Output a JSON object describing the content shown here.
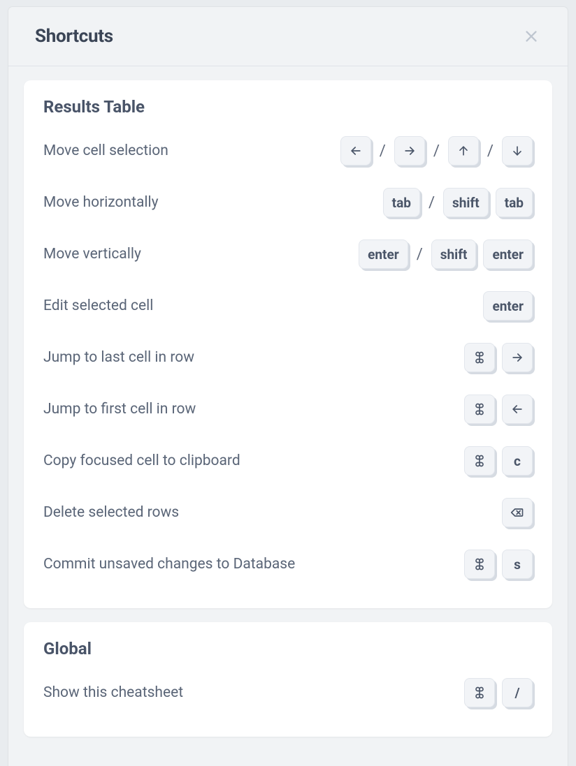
{
  "modal": {
    "title": "Shortcuts"
  },
  "sections": [
    {
      "title": "Results Table",
      "rows": [
        {
          "label": "Move cell selection",
          "keys": [
            {
              "type": "icon",
              "name": "arrow-left"
            },
            {
              "type": "sep",
              "text": "/"
            },
            {
              "type": "icon",
              "name": "arrow-right"
            },
            {
              "type": "sep",
              "text": "/"
            },
            {
              "type": "icon",
              "name": "arrow-up"
            },
            {
              "type": "sep",
              "text": "/"
            },
            {
              "type": "icon",
              "name": "arrow-down"
            }
          ]
        },
        {
          "label": "Move horizontally",
          "keys": [
            {
              "type": "text",
              "text": "tab"
            },
            {
              "type": "sep",
              "text": "/"
            },
            {
              "type": "text",
              "text": "shift"
            },
            {
              "type": "text",
              "text": "tab"
            }
          ]
        },
        {
          "label": "Move vertically",
          "keys": [
            {
              "type": "text",
              "text": "enter"
            },
            {
              "type": "sep",
              "text": "/"
            },
            {
              "type": "text",
              "text": "shift"
            },
            {
              "type": "text",
              "text": "enter"
            }
          ]
        },
        {
          "label": "Edit selected cell",
          "keys": [
            {
              "type": "text",
              "text": "enter"
            }
          ]
        },
        {
          "label": "Jump to last cell in row",
          "keys": [
            {
              "type": "icon",
              "name": "command"
            },
            {
              "type": "icon",
              "name": "arrow-right"
            }
          ]
        },
        {
          "label": "Jump to first cell in row",
          "keys": [
            {
              "type": "icon",
              "name": "command"
            },
            {
              "type": "icon",
              "name": "arrow-left"
            }
          ]
        },
        {
          "label": "Copy focused cell to clipboard",
          "keys": [
            {
              "type": "icon",
              "name": "command"
            },
            {
              "type": "text",
              "text": "c"
            }
          ]
        },
        {
          "label": "Delete selected rows",
          "keys": [
            {
              "type": "icon",
              "name": "backspace"
            }
          ]
        },
        {
          "label": "Commit unsaved changes to Database",
          "keys": [
            {
              "type": "icon",
              "name": "command"
            },
            {
              "type": "text",
              "text": "s"
            }
          ]
        }
      ]
    },
    {
      "title": "Global",
      "rows": [
        {
          "label": "Show this cheatsheet",
          "keys": [
            {
              "type": "icon",
              "name": "command"
            },
            {
              "type": "text",
              "text": "/"
            }
          ]
        }
      ]
    }
  ],
  "icons": {
    "arrow-left": "←",
    "arrow-right": "→",
    "arrow-up": "↑",
    "arrow-down": "↓",
    "command": "⌘",
    "backspace": "⌫"
  }
}
